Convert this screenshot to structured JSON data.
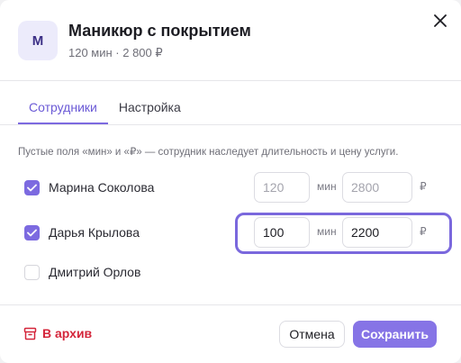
{
  "header": {
    "avatar_letter": "М",
    "title": "Маникюр с покрытием",
    "subtitle": "120 мин · 2 800 ₽"
  },
  "tabs": [
    {
      "label": "Сотрудники",
      "active": true
    },
    {
      "label": "Настройка",
      "active": false
    }
  ],
  "hint": "Пустые поля «мин» и «₽» — сотрудник наследует длительность и цену услуги.",
  "units": {
    "minutes": "мин",
    "currency": "₽"
  },
  "staff": [
    {
      "name": "Марина Соколова",
      "checked": true,
      "minutes": "120",
      "price": "2800",
      "overridden": false
    },
    {
      "name": "Дарья Крылова",
      "checked": true,
      "minutes": "100",
      "price": "2200",
      "overridden": true
    },
    {
      "name": "Дмитрий Орлов",
      "checked": false
    }
  ],
  "footer": {
    "archive_label": "В архив",
    "cancel_label": "Отмена",
    "save_label": "Сохранить"
  },
  "colors": {
    "accent": "#7c6ae0",
    "danger": "#d4253a"
  }
}
